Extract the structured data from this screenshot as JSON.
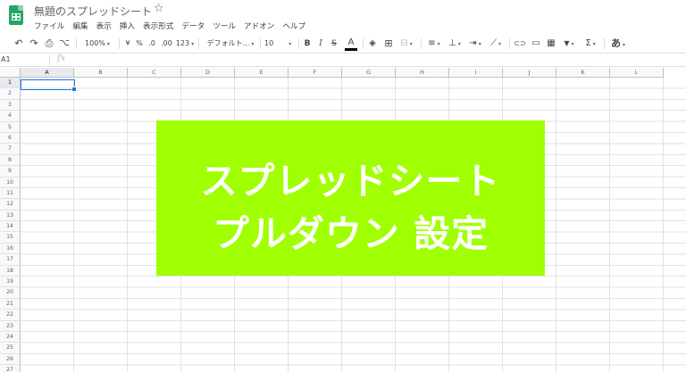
{
  "app": {
    "doc_title": "無題のスプレッドシート",
    "star_icon": "☆"
  },
  "menu": [
    "ファイル",
    "編集",
    "表示",
    "挿入",
    "表示形式",
    "データ",
    "ツール",
    "アドオン",
    "ヘルプ"
  ],
  "toolbar": {
    "undo": "↶",
    "redo": "↷",
    "print": "⎙",
    "paint_format": "⌥",
    "zoom": "100%",
    "currency": "¥",
    "percent": "%",
    "decimal_decrease": ".0",
    "decimal_increase": ".00",
    "more_formats": "123",
    "font": "デフォルト...",
    "font_size": "10",
    "bold": "B",
    "italic": "I",
    "strikethrough": "S",
    "text_color": "A",
    "fill": "◈",
    "borders": "⊞",
    "merge": "⊟",
    "halign": "≡",
    "valign": "⊥",
    "wrap": "⇥",
    "rotate": "⟋",
    "link": "⊂⊃",
    "comment": "▭",
    "chart": "▦",
    "filter": "▼",
    "functions": "Σ",
    "input_tools": "あ",
    "caret": "▾"
  },
  "formula_bar": {
    "namebox": "A1",
    "fx": "fx"
  },
  "grid": {
    "columns": [
      "A",
      "B",
      "C",
      "D",
      "E",
      "F",
      "G",
      "H",
      "I",
      "J",
      "K",
      "L"
    ],
    "rows": [
      "1",
      "2",
      "3",
      "4",
      "5",
      "6",
      "7",
      "8",
      "9",
      "10",
      "11",
      "12",
      "13",
      "14",
      "15",
      "16",
      "17",
      "18",
      "19",
      "20",
      "21",
      "22",
      "23",
      "24",
      "25",
      "26",
      "27"
    ],
    "selected_cell": "A1"
  },
  "banner": {
    "line1": "スプレッドシート",
    "line2": "プルダウン 設定",
    "background": "#a0ff00",
    "text_color": "#ffffff"
  },
  "colors": {
    "logo_green": "#23a566",
    "selection_blue": "#1a73e8"
  }
}
